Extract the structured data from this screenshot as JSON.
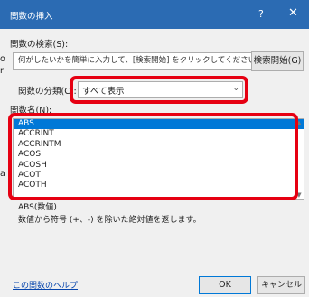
{
  "window": {
    "title": "関数の挿入",
    "help_glyph": "?",
    "close_glyph": "✕"
  },
  "side_fragments": [
    "o",
    "r",
    "a"
  ],
  "search": {
    "label": "関数の検索(S):",
    "value": "何がしたいかを簡単に入力して、[検索開始] をクリックしてください。",
    "button_label": "検索開始(G)"
  },
  "category": {
    "label": "関数の分類(C):",
    "selected": "すべて表示",
    "dropdown_icon": "chevron-down-icon"
  },
  "function_list": {
    "label": "関数名(N):",
    "items": [
      "ABS",
      "ACCRINT",
      "ACCRINTM",
      "ACOS",
      "ACOSH",
      "ACOT",
      "ACOTH"
    ],
    "selected_index": 0
  },
  "description": {
    "signature": "ABS(数値)",
    "text": "数値から符号 (+、-) を除いた絶対値を返します。"
  },
  "footer": {
    "help_link": "この関数のヘルプ",
    "ok_label": "OK",
    "cancel_label": "キャンセル"
  },
  "colors": {
    "title_bar": "#2b6bb3",
    "highlight_box": "#e60012",
    "selection": "#0078d7"
  }
}
